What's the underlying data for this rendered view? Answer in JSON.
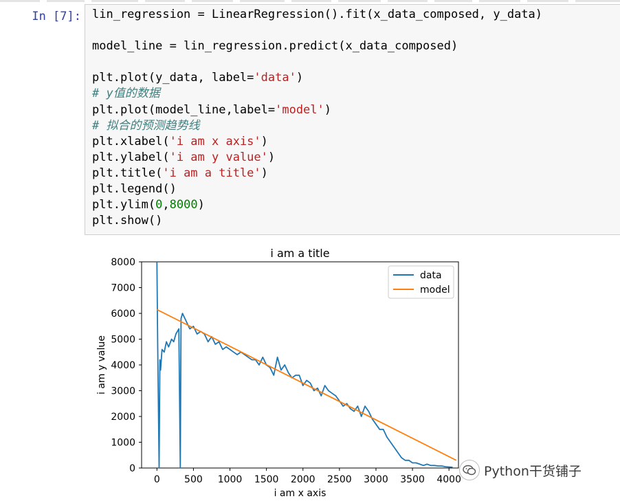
{
  "notebook": {
    "prompt": "In  [7]:",
    "code_lines": [
      [
        {
          "t": "lin_regression = LinearRegression().fit(x_data_composed, y_data)",
          "c": ""
        }
      ],
      [
        {
          "t": "",
          "c": ""
        }
      ],
      [
        {
          "t": "model_line = lin_regression.predict(x_data_composed)",
          "c": ""
        }
      ],
      [
        {
          "t": "",
          "c": ""
        }
      ],
      [
        {
          "t": "plt.plot(y_data, label=",
          "c": ""
        },
        {
          "t": "'data'",
          "c": "str"
        },
        {
          "t": ")",
          "c": ""
        }
      ],
      [
        {
          "t": "# y值的数据",
          "c": "com"
        }
      ],
      [
        {
          "t": "plt.plot(model_line,label=",
          "c": ""
        },
        {
          "t": "'model'",
          "c": "str"
        },
        {
          "t": ")",
          "c": ""
        }
      ],
      [
        {
          "t": "# 拟合的预测趋势线",
          "c": "com"
        }
      ],
      [
        {
          "t": "plt.xlabel(",
          "c": ""
        },
        {
          "t": "'i am x axis'",
          "c": "str"
        },
        {
          "t": ")",
          "c": ""
        }
      ],
      [
        {
          "t": "plt.ylabel(",
          "c": ""
        },
        {
          "t": "'i am y value'",
          "c": "str"
        },
        {
          "t": ")",
          "c": ""
        }
      ],
      [
        {
          "t": "plt.title(",
          "c": ""
        },
        {
          "t": "'i am a title'",
          "c": "str"
        },
        {
          "t": ")",
          "c": ""
        }
      ],
      [
        {
          "t": "plt.legend()",
          "c": ""
        }
      ],
      [
        {
          "t": "plt.ylim(",
          "c": ""
        },
        {
          "t": "0",
          "c": "num"
        },
        {
          "t": ",",
          "c": ""
        },
        {
          "t": "8000",
          "c": "num"
        },
        {
          "t": ")",
          "c": ""
        }
      ],
      [
        {
          "t": "plt.show()",
          "c": ""
        }
      ]
    ]
  },
  "watermark": {
    "text": "Python干货铺子",
    "icon": "wechat-icon"
  },
  "colors": {
    "data": "#1f77b4",
    "model": "#ff7f0e"
  },
  "chart_data": {
    "type": "line",
    "title": "i am a title",
    "xlabel": "i am x axis",
    "ylabel": "i am y value",
    "xlim": [
      -210,
      4130
    ],
    "ylim": [
      0,
      8000
    ],
    "xticks": [
      0,
      500,
      1000,
      1500,
      2000,
      2500,
      3000,
      3500,
      4000
    ],
    "yticks": [
      0,
      1000,
      2000,
      3000,
      4000,
      5000,
      6000,
      7000,
      8000
    ],
    "legend": {
      "location": "upper right",
      "entries": [
        "data",
        "model"
      ]
    },
    "grid": false,
    "series": [
      {
        "name": "data",
        "x": [
          0,
          10,
          30,
          40,
          50,
          70,
          100,
          130,
          160,
          200,
          230,
          260,
          300,
          320,
          330,
          350,
          400,
          450,
          500,
          550,
          600,
          650,
          700,
          750,
          800,
          850,
          900,
          950,
          1000,
          1050,
          1100,
          1150,
          1200,
          1250,
          1300,
          1350,
          1400,
          1450,
          1500,
          1550,
          1600,
          1650,
          1700,
          1750,
          1800,
          1850,
          1900,
          1950,
          2000,
          2050,
          2100,
          2150,
          2200,
          2250,
          2300,
          2350,
          2400,
          2450,
          2500,
          2550,
          2600,
          2650,
          2700,
          2750,
          2800,
          2850,
          2900,
          2950,
          3000,
          3050,
          3100,
          3150,
          3200,
          3250,
          3300,
          3350,
          3400,
          3450,
          3500,
          3550,
          3600,
          3650,
          3700,
          3750,
          3800,
          3850,
          3900,
          3950,
          4000,
          4050
        ],
        "y": [
          8000,
          4800,
          0,
          4200,
          3800,
          4600,
          4500,
          4900,
          4700,
          5000,
          4900,
          5200,
          5400,
          0,
          5800,
          6000,
          5700,
          5400,
          5500,
          5200,
          5300,
          5200,
          4900,
          5100,
          4800,
          4900,
          4600,
          4700,
          4600,
          4500,
          4400,
          4500,
          4400,
          4300,
          4200,
          4200,
          4000,
          4300,
          4000,
          3900,
          3600,
          4300,
          3800,
          4000,
          3700,
          3500,
          3600,
          3600,
          3200,
          3400,
          3300,
          3000,
          3100,
          2800,
          3200,
          3000,
          2900,
          2800,
          2600,
          2400,
          2500,
          2300,
          2200,
          2400,
          2000,
          2400,
          2200,
          1900,
          1700,
          1500,
          1500,
          1200,
          1000,
          800,
          600,
          400,
          300,
          300,
          200,
          200,
          150,
          100,
          150,
          100,
          100,
          80,
          80,
          50,
          40,
          30
        ]
      },
      {
        "name": "model",
        "x": [
          0,
          4100
        ],
        "y": [
          6150,
          300
        ]
      }
    ]
  }
}
